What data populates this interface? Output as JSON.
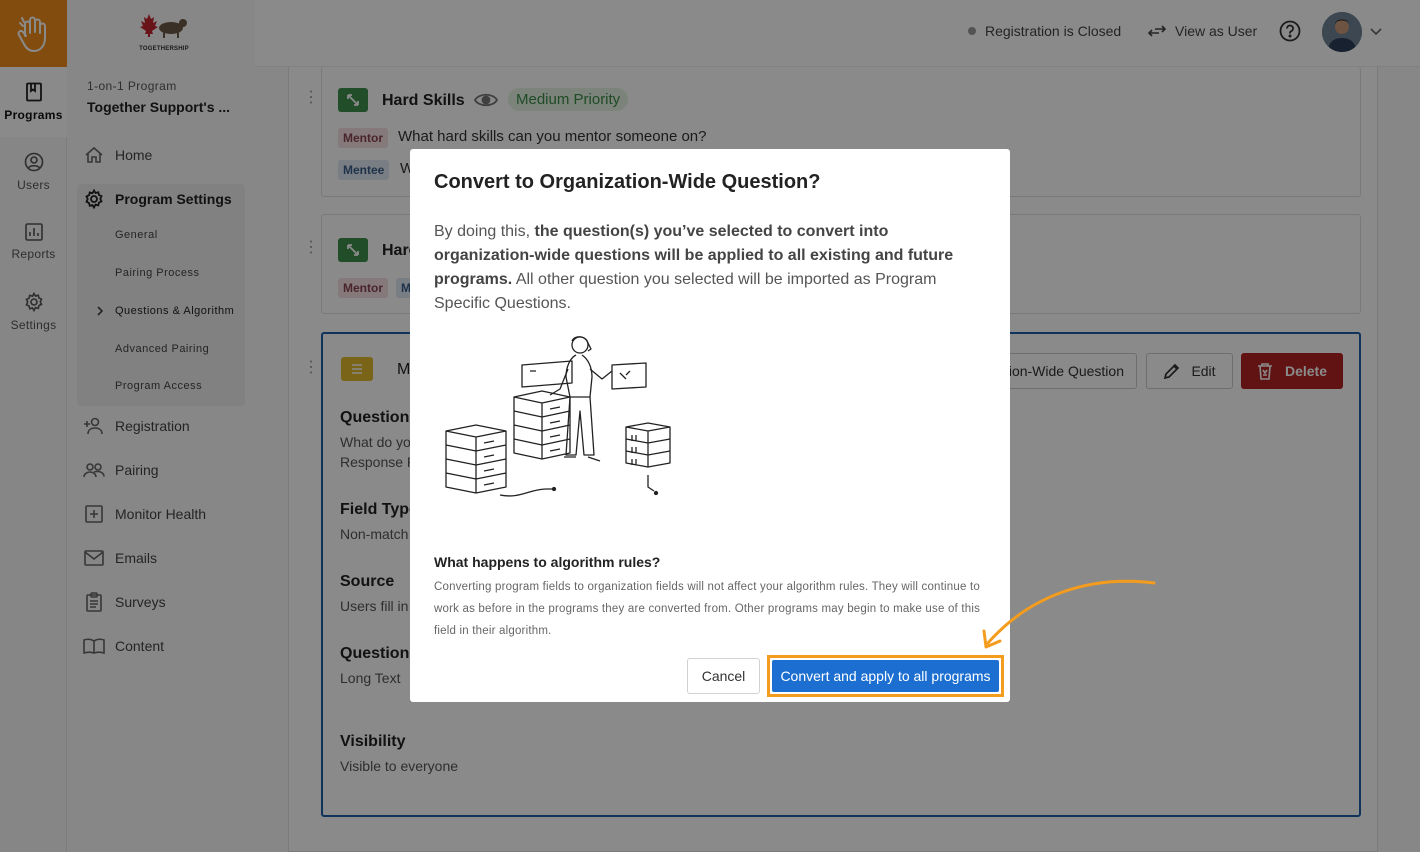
{
  "rail": {
    "items": [
      {
        "label": "Programs",
        "icon": "book-icon"
      },
      {
        "label": "Users",
        "icon": "user-circle-icon"
      },
      {
        "label": "Reports",
        "icon": "report-chart-icon"
      },
      {
        "label": "Settings",
        "icon": "gear-icon"
      }
    ]
  },
  "brand": {
    "text": "TOGETHERSHIP"
  },
  "program": {
    "type": "1-on-1 Program",
    "name": "Together Support's ..."
  },
  "nav": {
    "home": "Home",
    "program_settings": "Program Settings",
    "sub": [
      "General",
      "Pairing Process",
      "Questions & Algorithm",
      "Advanced Pairing",
      "Program Access"
    ],
    "registration": "Registration",
    "pairing": "Pairing",
    "monitor_health": "Monitor Health",
    "emails": "Emails",
    "surveys": "Surveys",
    "content": "Content"
  },
  "topbar": {
    "registration_status": "Registration is Closed",
    "view_as_user": "View as User"
  },
  "cards": {
    "card1": {
      "title": "Hard Skills",
      "priority": "Medium Priority",
      "mentor_tag": "Mentor",
      "mentor_question": "What hard skills can you mentor someone on?",
      "mentee_tag": "Mentee",
      "mentee_question": "W"
    },
    "card2": {
      "title": "Harc",
      "mentor_tag": "Mentor",
      "mentee_tag": "Me"
    },
    "card3": {
      "title_fragment": "M",
      "convert_button": "ion-Wide Question",
      "edit_button": "Edit",
      "delete_button": "Delete",
      "question_label": "Question",
      "question_value": "What do yo",
      "response_value": "Response R",
      "field_type_label": "Field Type",
      "field_type_value": "Non-match",
      "source_label": "Source",
      "source_value": "Users fill in",
      "question_type_label": "Question",
      "question_type_value": "Long Text",
      "visibility_label": "Visibility",
      "visibility_value": "Visible to everyone"
    }
  },
  "modal": {
    "title": "Convert to Organization-Wide Question?",
    "body_prefix": "By doing this, ",
    "body_bold": "the question(s) you’ve selected to convert into organization-wide questions will be applied to all existing and future programs.",
    "body_suffix": " All other question you selected will be imported as Program Specific Questions.",
    "subheading": "What happens to algorithm rules?",
    "note": "Converting program fields to organization fields will not affect your algorithm rules. They will continue to work as before in the programs they are converted from. Other programs may begin to make use of this field in their algorithm.",
    "cancel": "Cancel",
    "confirm": "Convert and apply to all programs"
  },
  "colors": {
    "accent_orange": "#f08c1a",
    "primary_blue": "#1c6fd1",
    "delete_red": "#b42424",
    "highlight_orange": "#f39c1e"
  }
}
